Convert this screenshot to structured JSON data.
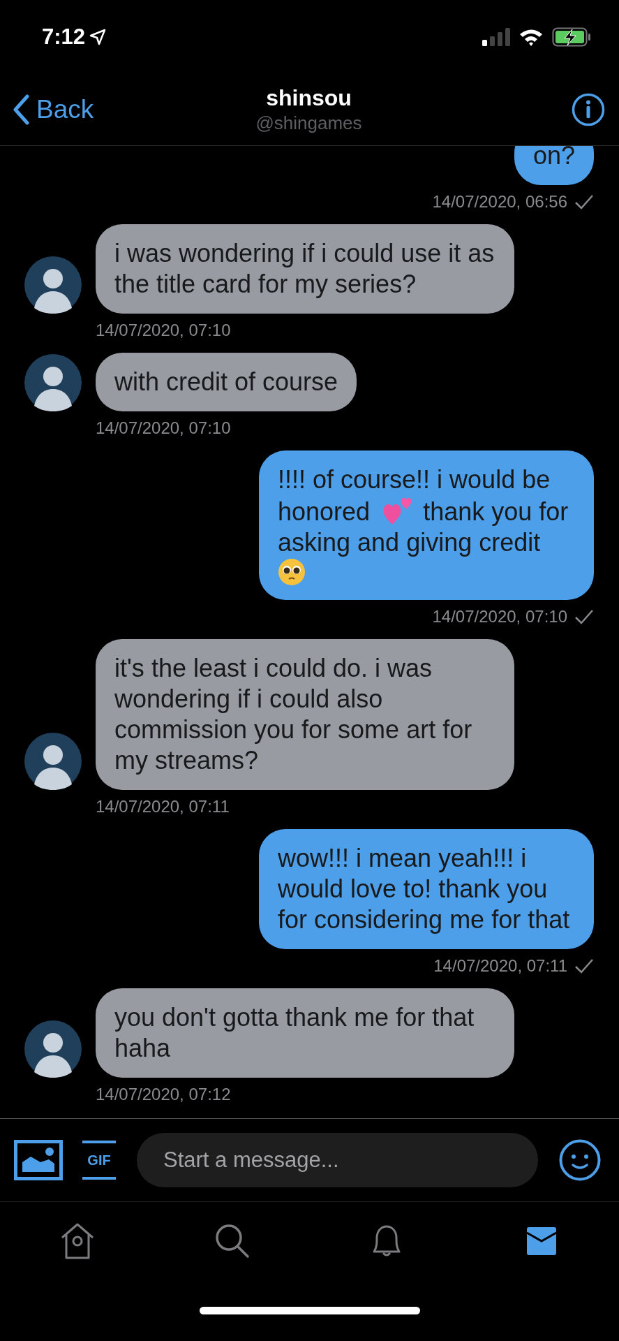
{
  "status_bar": {
    "time": "7:12"
  },
  "header": {
    "back_label": "Back",
    "title": "shinsou",
    "handle": "@shingames"
  },
  "messages": [
    {
      "outgoing": true,
      "segments": [
        {
          "kind": "text",
          "text": "on?"
        }
      ],
      "timestamp": "14/07/2020, 06:56"
    },
    {
      "outgoing": false,
      "segments": [
        {
          "kind": "text",
          "text": "i was wondering if i could use it as the title card for my series?"
        }
      ],
      "timestamp": "14/07/2020, 07:10"
    },
    {
      "outgoing": false,
      "segments": [
        {
          "kind": "text",
          "text": "with credit of course"
        }
      ],
      "timestamp": "14/07/2020, 07:10"
    },
    {
      "outgoing": true,
      "segments": [
        {
          "kind": "text",
          "text": "!!!! of course!! i would be"
        },
        {
          "kind": "text",
          "text": "honored"
        },
        {
          "kind": "hearts_emoji"
        },
        {
          "kind": "text",
          "text": "thank you for"
        },
        {
          "kind": "text",
          "text": "asking and giving credit"
        },
        {
          "kind": "pleading_emoji"
        }
      ],
      "timestamp": "14/07/2020, 07:10"
    },
    {
      "outgoing": false,
      "segments": [
        {
          "kind": "text",
          "text": "it's the least i could do. i was wondering if i could also commission you for some art for my streams?"
        }
      ],
      "timestamp": "14/07/2020, 07:11"
    },
    {
      "outgoing": true,
      "segments": [
        {
          "kind": "text",
          "text": "wow!!! i mean yeah!!! i would love to! thank you for considering me for that"
        }
      ],
      "timestamp": "14/07/2020, 07:11"
    },
    {
      "outgoing": false,
      "segments": [
        {
          "kind": "text",
          "text": "you don't gotta thank me for that haha"
        }
      ],
      "timestamp": "14/07/2020, 07:12"
    }
  ],
  "composer": {
    "gif_label": "GIF",
    "placeholder": "Start a message..."
  },
  "tabs": [
    {
      "kind": "home",
      "selected": false
    },
    {
      "kind": "search",
      "selected": false
    },
    {
      "kind": "notifications",
      "selected": false
    },
    {
      "kind": "messages",
      "selected": true
    }
  ]
}
